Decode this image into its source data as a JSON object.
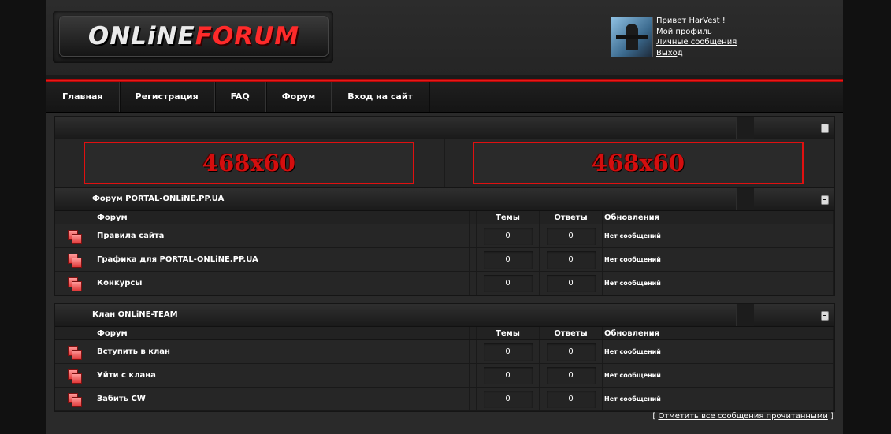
{
  "header": {
    "logo_part1": "ONLiNE",
    "logo_part2": "FORUM"
  },
  "user": {
    "greeting": "Привет",
    "username": "HarVest",
    "greeting_suffix": "!",
    "links": [
      "Мой профиль",
      "Личные сообщения",
      "Выход"
    ]
  },
  "nav": {
    "items": [
      "Главная",
      "Регистрация",
      "FAQ",
      "Форум",
      "Вход на сайт"
    ]
  },
  "banners": [
    "468x60",
    "468x60"
  ],
  "columns": {
    "forum": "Форум",
    "topics": "Темы",
    "replies": "Ответы",
    "updates": "Обновления"
  },
  "categories": [
    {
      "title": "Форум PORTAL-ONLiNE.PP.UA",
      "forums": [
        {
          "name": "Правила сайта",
          "topics": "0",
          "replies": "0",
          "last": "Нет сообщений"
        },
        {
          "name": "Графика для PORTAL-ONLiNE.PP.UA",
          "topics": "0",
          "replies": "0",
          "last": "Нет сообщений"
        },
        {
          "name": "Конкурсы",
          "topics": "0",
          "replies": "0",
          "last": "Нет сообщений"
        }
      ]
    },
    {
      "title": "Клан ONLiNE-TEAM",
      "forums": [
        {
          "name": "Вступить в клан",
          "topics": "0",
          "replies": "0",
          "last": "Нет сообщений"
        },
        {
          "name": "Уйти с клана",
          "topics": "0",
          "replies": "0",
          "last": "Нет сообщений"
        },
        {
          "name": "Забить CW",
          "topics": "0",
          "replies": "0",
          "last": "Нет сообщений"
        }
      ]
    }
  ],
  "footer": {
    "bracket_open": "[",
    "mark_read": "Отметить все сообщения прочитанными",
    "bracket_close": "]"
  },
  "colors": {
    "accent": "#ff2020",
    "background": "#2a2a2a",
    "banner_border": "#e01010"
  }
}
